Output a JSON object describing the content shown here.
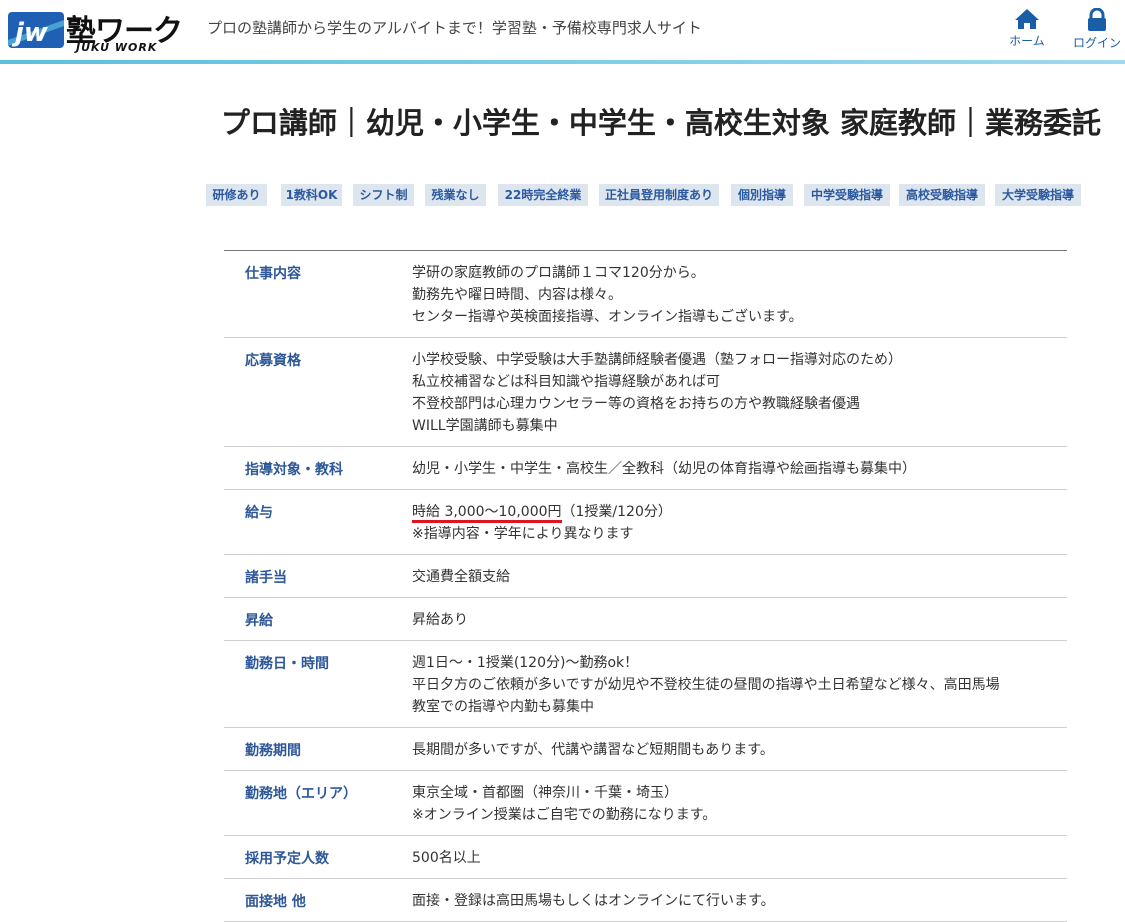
{
  "header": {
    "logo_text": "塾ワーク",
    "logo_sub": "JUKU WORK",
    "logo_mark": "jw",
    "tagline": "プロの塾講師から学生のアルバイトまで！学習塾・予備校専門求人サイト",
    "nav": {
      "home_label": "ホーム",
      "login_label": "ログイン"
    },
    "accent_color": "#5bc0de",
    "nav_color": "#1a5ea8"
  },
  "page_title": "プロ講師｜幼児・小学生・中学生・高校生対象 家庭教師｜業務委託",
  "tags": [
    "研修あり",
    "1教科OK",
    "シフト制",
    "残業なし",
    "22時完全終業",
    "正社員登用制度あり",
    "個別指導",
    "中学受験指導",
    "高校受験指導",
    "大学受験指導"
  ],
  "job_details": [
    {
      "label": "仕事内容",
      "lines": [
        "学研の家庭教師のプロ講師１コマ120分から。",
        "勤務先や曜日時間、内容は様々。",
        "センター指導や英検面接指導、オンライン指導もございます。"
      ]
    },
    {
      "label": "応募資格",
      "lines": [
        "小学校受験、中学受験は大手塾講師経験者優遇（塾フォロー指導対応のため）",
        "私立校補習などは科目知識や指導経験があれば可",
        "不登校部門は心理カウンセラー等の資格をお持ちの方や教職経験者優遇",
        "WILL学園講師も募集中"
      ]
    },
    {
      "label": "指導対象・教科",
      "lines": [
        "幼児・小学生・中学生・高校生／全教科（幼児の体育指導や絵画指導も募集中）"
      ]
    },
    {
      "label": "給与",
      "salary_highlight": "時給 3,000〜10,000円",
      "salary_rest": "（1授業/120分）",
      "lines": [
        "※指導内容・学年により異なります"
      ]
    },
    {
      "label": "諸手当",
      "lines": [
        "交通費全額支給"
      ]
    },
    {
      "label": "昇給",
      "lines": [
        "昇給あり"
      ]
    },
    {
      "label": "勤務日・時間",
      "lines": [
        "週1日〜・1授業(120分)〜勤務ok！",
        "平日夕方のご依頼が多いですが幼児や不登校生徒の昼間の指導や土日希望など様々、高田馬場",
        "教室での指導や内勤も募集中"
      ]
    },
    {
      "label": "勤務期間",
      "lines": [
        "長期間が多いですが、代講や講習など短期間もあります。"
      ]
    },
    {
      "label": "勤務地（エリア）",
      "lines": [
        "東京全域・首都圏（神奈川・千葉・埼玉）",
        "※オンライン授業はご自宅での勤務になります。"
      ]
    },
    {
      "label": "採用予定人数",
      "lines": [
        "500名以上"
      ]
    },
    {
      "label": "面接地 他",
      "lines": [
        "面接・登録は高田馬場もしくはオンラインにて行います。"
      ]
    }
  ]
}
